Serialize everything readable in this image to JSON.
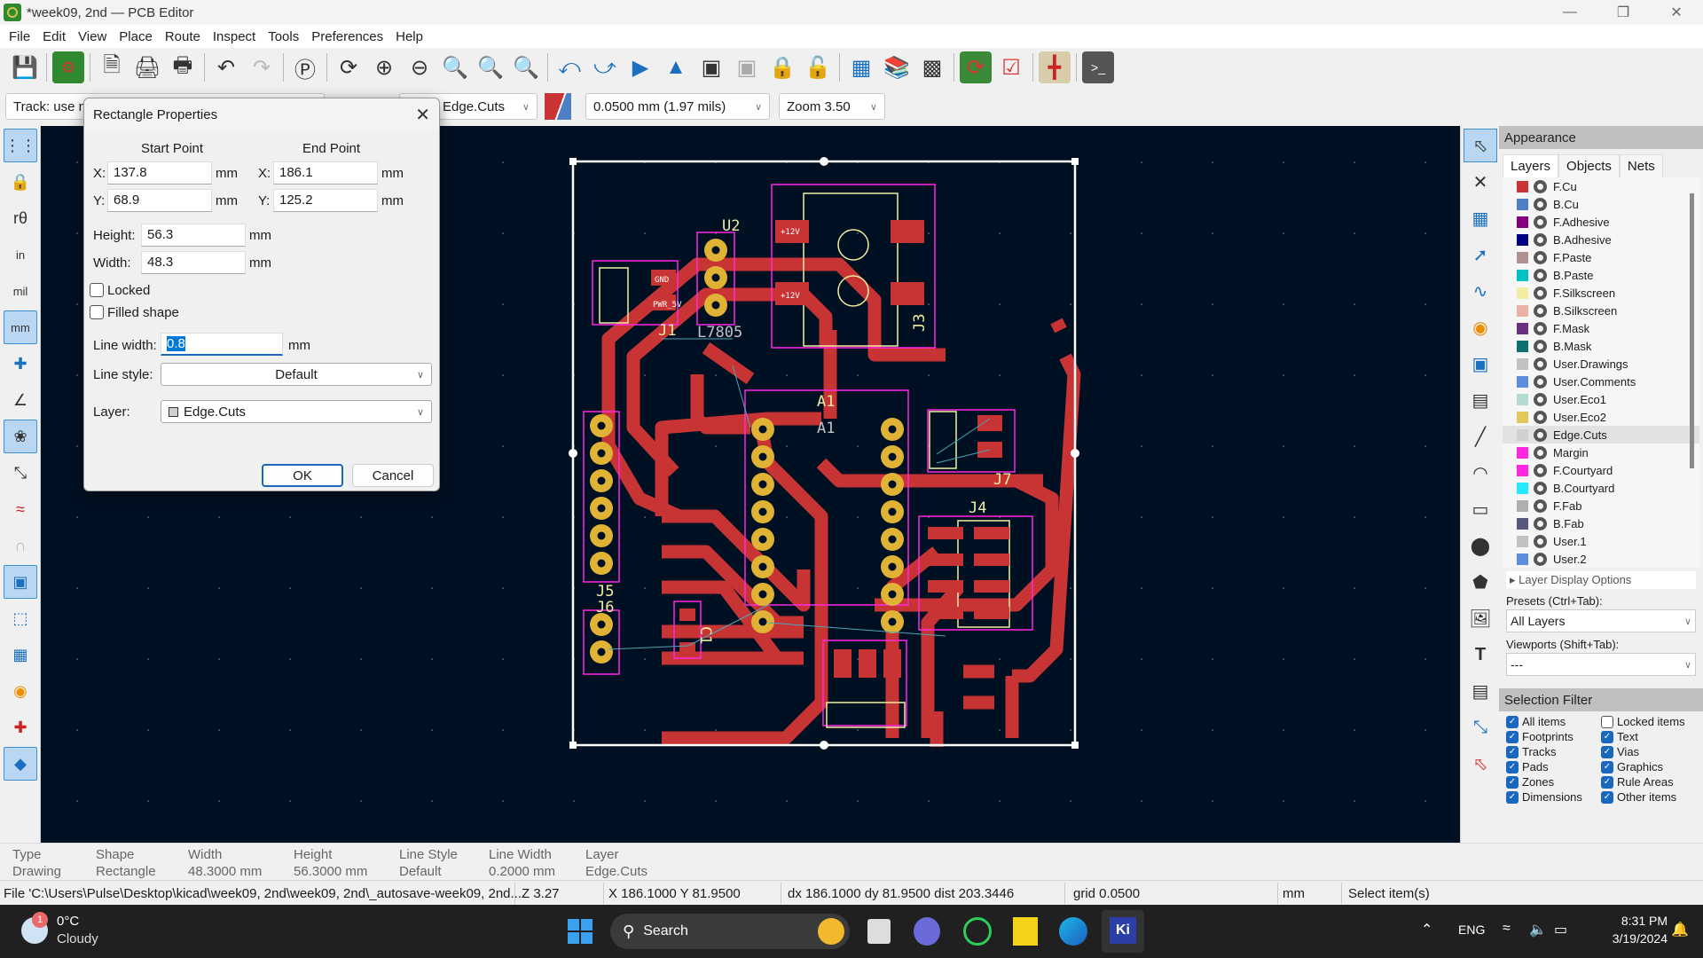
{
  "window": {
    "title": "*week09, 2nd — PCB Editor",
    "minimize": "—",
    "restore": "❐",
    "close": "✕"
  },
  "menu": [
    "File",
    "Edit",
    "View",
    "Place",
    "Route",
    "Inspect",
    "Tools",
    "Preferences",
    "Help"
  ],
  "toolbar_icons": [
    "save-icon",
    "board-setup-icon",
    "page-settings-icon",
    "print-icon",
    "plot-icon",
    "undo-icon",
    "redo-icon",
    "find-icon",
    "redraw-icon",
    "zoom-in-icon",
    "zoom-out-icon",
    "zoom-fit-icon",
    "zoom-objects-icon",
    "zoom-selection-icon",
    "rotate-ccw-icon",
    "rotate-cw-icon",
    "flip-icon",
    "mirror-icon",
    "group-icon",
    "ungroup-icon",
    "lock-icon",
    "unlock-icon",
    "footprint-editor-icon",
    "footprint-browser-icon",
    "3d-viewer-icon",
    "update-pcb-icon",
    "drc-icon",
    "schematic-icon",
    "scripting-console-icon"
  ],
  "auxbar": {
    "track": "Track: use net",
    "layer": "Edge.Cuts",
    "grid": "0.0500 mm (1.97 mils)",
    "zoom": "Zoom 3.50"
  },
  "dialog": {
    "title": "Rectangle Properties",
    "start_label": "Start Point",
    "end_label": "End Point",
    "start_x": "137.8",
    "start_y": "68.9",
    "end_x": "186.1",
    "end_y": "125.2",
    "x_label": "X:",
    "y_label": "Y:",
    "unit": "mm",
    "height_label": "Height:",
    "height": "56.3",
    "width_label": "Width:",
    "width": "48.3",
    "locked_label": "Locked",
    "locked": false,
    "filled_label": "Filled shape",
    "filled": false,
    "line_width_label": "Line width:",
    "line_width": "0.8",
    "line_style_label": "Line style:",
    "line_style": "Default",
    "layer_label": "Layer:",
    "layer": "Edge.Cuts",
    "ok": "OK",
    "cancel": "Cancel"
  },
  "pcb_labels": {
    "u2": "U2",
    "j1": "J1",
    "l7805": "L7805",
    "j3a": "J3",
    "j3b": "J3",
    "a1a": "A1",
    "a1b": "A1",
    "j7": "J7",
    "j4": "J4",
    "j5": "J5",
    "j6": "J6",
    "c1": "C1",
    "pad_12v": "+12V",
    "pad_gnd": "GND",
    "pad_5v": "PWR_5V"
  },
  "appearance": {
    "title": "Appearance",
    "tabs": [
      "Layers",
      "Objects",
      "Nets"
    ],
    "layers": [
      {
        "name": "F.Cu",
        "color": "#c83434"
      },
      {
        "name": "B.Cu",
        "color": "#4d7fc4"
      },
      {
        "name": "F.Adhesive",
        "color": "#84007e"
      },
      {
        "name": "B.Adhesive",
        "color": "#000084"
      },
      {
        "name": "F.Paste",
        "color": "#b09090"
      },
      {
        "name": "B.Paste",
        "color": "#00c2c2"
      },
      {
        "name": "F.Silkscreen",
        "color": "#f2eda1"
      },
      {
        "name": "B.Silkscreen",
        "color": "#e8b2a7"
      },
      {
        "name": "F.Mask",
        "color": "#6a2f7e"
      },
      {
        "name": "B.Mask",
        "color": "#107070"
      },
      {
        "name": "User.Drawings",
        "color": "#c2c2c2"
      },
      {
        "name": "User.Comments",
        "color": "#5b8fdc"
      },
      {
        "name": "User.Eco1",
        "color": "#b4dbd2"
      },
      {
        "name": "User.Eco2",
        "color": "#e2c85a"
      },
      {
        "name": "Edge.Cuts",
        "color": "#d0d0d0",
        "selected": true
      },
      {
        "name": "Margin",
        "color": "#ff26e2"
      },
      {
        "name": "F.Courtyard",
        "color": "#ff26e2"
      },
      {
        "name": "B.Courtyard",
        "color": "#26e9ff"
      },
      {
        "name": "F.Fab",
        "color": "#afafaf"
      },
      {
        "name": "B.Fab",
        "color": "#58587e"
      },
      {
        "name": "User.1",
        "color": "#c2c2c2"
      },
      {
        "name": "User.2",
        "color": "#5b8fdc"
      }
    ],
    "layer_display_options": "Layer Display Options",
    "presets_label": "Presets (Ctrl+Tab):",
    "presets_value": "All Layers",
    "viewports_label": "Viewports (Shift+Tab):",
    "viewports_value": "---"
  },
  "selection_filter": {
    "title": "Selection Filter",
    "items": [
      {
        "label": "All items",
        "checked": true
      },
      {
        "label": "Locked items",
        "checked": false
      },
      {
        "label": "Footprints",
        "checked": true
      },
      {
        "label": "Text",
        "checked": true
      },
      {
        "label": "Tracks",
        "checked": true
      },
      {
        "label": "Vias",
        "checked": true
      },
      {
        "label": "Pads",
        "checked": true
      },
      {
        "label": "Graphics",
        "checked": true
      },
      {
        "label": "Zones",
        "checked": true
      },
      {
        "label": "Rule Areas",
        "checked": true
      },
      {
        "label": "Dimensions",
        "checked": true
      },
      {
        "label": "Other items",
        "checked": true
      }
    ]
  },
  "message_panel": [
    {
      "label": "Type",
      "value": "Drawing"
    },
    {
      "label": "Shape",
      "value": "Rectangle"
    },
    {
      "label": "Width",
      "value": "48.3000 mm"
    },
    {
      "label": "Height",
      "value": "56.3000 mm"
    },
    {
      "label": "Line Style",
      "value": "Default"
    },
    {
      "label": "Line Width",
      "value": "0.2000 mm"
    },
    {
      "label": "Layer",
      "value": "Edge.Cuts"
    }
  ],
  "status": {
    "file": "File 'C:\\Users\\Pulse\\Desktop\\kicad\\week09, 2nd\\week09, 2nd\\_autosave-week09, 2nd....",
    "zoom": "Z 3.27",
    "pos": "X 186.1000  Y 81.9500",
    "delta": "dx 186.1000  dy 81.9500  dist 203.3446",
    "grid": "grid 0.0500",
    "units": "mm",
    "mode": "Select item(s)"
  },
  "taskbar": {
    "weather_temp": "0°C",
    "weather_desc": "Cloudy",
    "weather_badge": "1",
    "search": "Search",
    "lang": "ENG",
    "time": "8:31 PM",
    "date": "3/19/2024"
  }
}
